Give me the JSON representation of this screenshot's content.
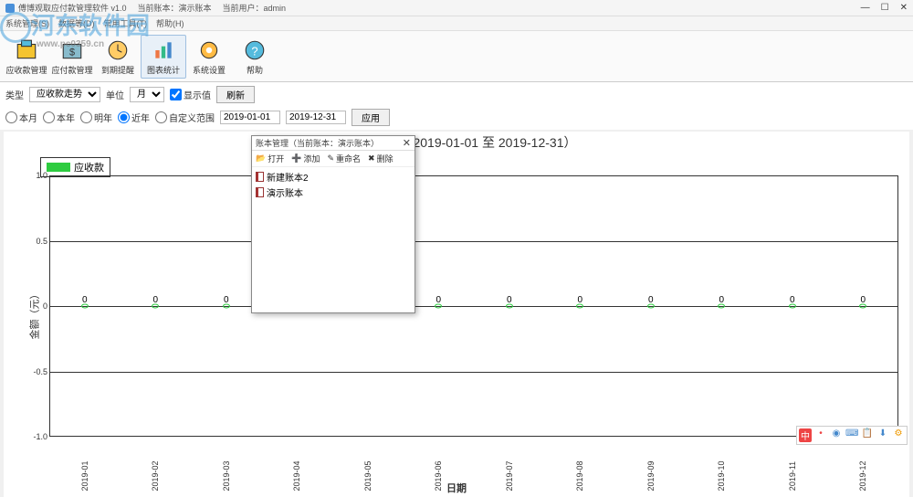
{
  "titlebar": {
    "app": "傅博观取应付款管理软件  v1.0",
    "current_book": "当前账本：演示账本",
    "current_user": "当前用户：admin"
  },
  "menubar": [
    "系统管理(S)",
    "数据等(D)",
    "常用工具(T)",
    "帮助(H)"
  ],
  "watermark": {
    "text": "河东软件园",
    "url": "www.pc0359.cn"
  },
  "toolbar": [
    {
      "label": "应收款管理"
    },
    {
      "label": "应付款管理"
    },
    {
      "label": "到期提醒"
    },
    {
      "label": "图表统计",
      "active": true
    },
    {
      "label": "系统设置"
    },
    {
      "label": "帮助"
    }
  ],
  "filter": {
    "type_label": "类型",
    "type_value": "应收款走势",
    "unit_label": "单位",
    "unit_value": "月",
    "show_value": "显示值",
    "refresh": "刷新",
    "radios": [
      "本月",
      "本年",
      "明年",
      "近年"
    ],
    "radio_selected": 3,
    "custom_range": "自定义范围",
    "date_from": "2019-01-01",
    "date_to": "2019-12-31",
    "apply": "应用"
  },
  "chart_data": {
    "type": "line",
    "title": "应收款走势（2019-01-01 至 2019-12-31）",
    "legend": "应收款",
    "xlabel": "日期",
    "ylabel": "金额（元）",
    "ylim": [
      -1.0,
      1.0
    ],
    "yticks": [
      -1.0,
      -0.5,
      0,
      0.5,
      1.0
    ],
    "categories": [
      "2019-01",
      "2019-02",
      "2019-03",
      "2019-04",
      "2019-05",
      "2019-06",
      "2019-07",
      "2019-08",
      "2019-09",
      "2019-10",
      "2019-11",
      "2019-12"
    ],
    "values": [
      0,
      0,
      0,
      0,
      0,
      0,
      0,
      0,
      0,
      0,
      0,
      0
    ]
  },
  "dialog": {
    "title": "账本管理（当前账本：演示账本）",
    "tools": [
      "打开",
      "添加",
      "重命名",
      "删除"
    ],
    "items": [
      "新建账本2",
      "演示账本"
    ]
  },
  "ime": [
    "中",
    "•",
    "◉",
    "⌨",
    "📋",
    "⬇",
    "⚙"
  ]
}
